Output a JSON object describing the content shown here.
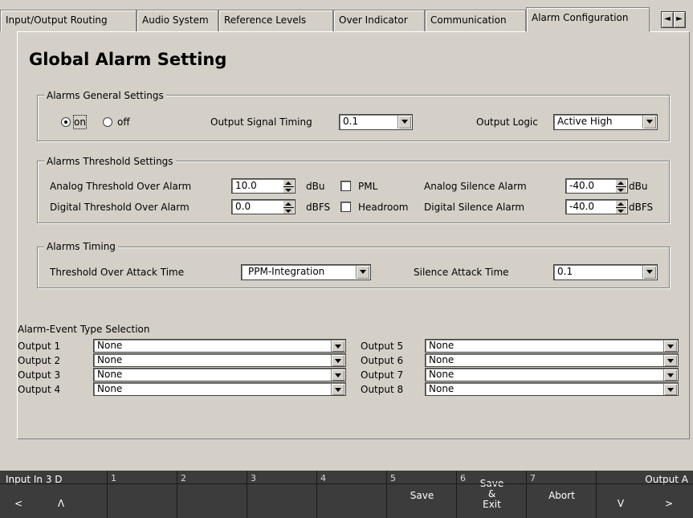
{
  "tabs": [
    "Input/Output Routing",
    "Audio System",
    "Reference Levels",
    "Over Indicator",
    "Communication",
    "Alarm Configuration"
  ],
  "page_title": "Global Alarm Setting",
  "general": {
    "legend": "Alarms General Settings",
    "radio_on": "on",
    "radio_off": "off",
    "signal_timing_label": "Output Signal Timing",
    "signal_timing_value": "0.1",
    "logic_label": "Output Logic",
    "logic_value": "Active High"
  },
  "threshold": {
    "legend": "Alarms Threshold Settings",
    "analog_over_label": "Analog Threshold Over Alarm",
    "analog_over_value": "10.0",
    "analog_over_unit": "dBu",
    "pml_label": "PML",
    "analog_silence_label": "Analog Silence Alarm",
    "analog_silence_value": "-40.0",
    "analog_silence_unit": "dBu",
    "digital_over_label": "Digital Threshold Over Alarm",
    "digital_over_value": "0.0",
    "digital_over_unit": "dBFS",
    "headroom_label": "Headroom",
    "digital_silence_label": "Digital Silence Alarm",
    "digital_silence_value": "-40.0",
    "digital_silence_unit": "dBFS"
  },
  "timing": {
    "legend": "Alarms Timing",
    "attack_label": "Threshold Over Attack Time",
    "attack_value": "PPM-Integration",
    "silence_label": "Silence Attack Time",
    "silence_value": "0.1"
  },
  "event_selection": {
    "heading": "Alarm-Event Type Selection",
    "outputs": [
      {
        "label": "Output 1",
        "value": "None"
      },
      {
        "label": "Output 2",
        "value": "None"
      },
      {
        "label": "Output 3",
        "value": "None"
      },
      {
        "label": "Output 4",
        "value": "None"
      },
      {
        "label": "Output 5",
        "value": "None"
      },
      {
        "label": "Output 6",
        "value": "None"
      },
      {
        "label": "Output 7",
        "value": "None"
      },
      {
        "label": "Output 8",
        "value": "None"
      }
    ]
  },
  "softkeys": {
    "input_label": "Input In 3 D",
    "left_arrow": "<",
    "up_arrow": "Λ",
    "nums": [
      "1",
      "2",
      "3",
      "4",
      "5",
      "6",
      "7"
    ],
    "save": "Save",
    "save_exit": "Save\n&\nExit",
    "abort": "Abort",
    "output_label": "Output A",
    "down_arrow": "V",
    "right_arrow": ">"
  },
  "icons": [
    "scroll-left-icon",
    "scroll-right-icon",
    "dropdown-arrow-icon",
    "spinner-icon"
  ]
}
